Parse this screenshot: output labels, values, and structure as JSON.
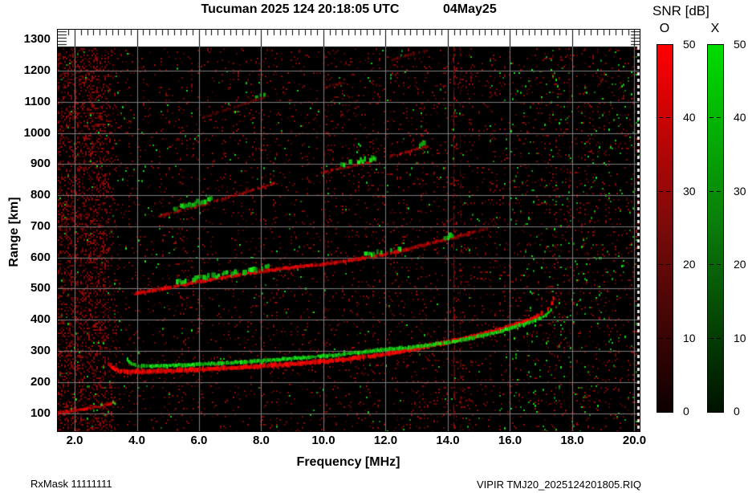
{
  "header": {
    "title": "Tucuman 2025 124 20:18:05 UTC",
    "date": "04May25"
  },
  "axes": {
    "x_label": "Frequency [MHz]",
    "y_label": "Range [km]",
    "x_ticks": [
      "2.0",
      "4.0",
      "6.0",
      "8.0",
      "10.0",
      "12.0",
      "14.0",
      "16.0",
      "18.0",
      "20.0"
    ],
    "y_ticks": [
      "100",
      "200",
      "300",
      "400",
      "500",
      "600",
      "700",
      "800",
      "900",
      "1000",
      "1100",
      "1200",
      "1300"
    ]
  },
  "colorbar_panel": {
    "title": "SNR [dB]",
    "scale_db": [
      0,
      50
    ],
    "bars": [
      {
        "label": "O",
        "top_color": "#ff0000",
        "mid_color": "#7a0a0a",
        "bottom_color": "#0d0000",
        "ticks": [
          "50",
          "40",
          "30",
          "20",
          "10",
          "0"
        ]
      },
      {
        "label": "X",
        "top_color": "#00dd00",
        "mid_color": "#0a7a0a",
        "bottom_color": "#001200",
        "ticks": [
          "50",
          "40",
          "30",
          "20",
          "10",
          "0"
        ]
      }
    ]
  },
  "footer": {
    "left": "RxMask 11111111",
    "right": "VIPIR  TMJ20_2025124201805.RIQ"
  },
  "chart_data": {
    "type": "heatmap",
    "title": "Tucuman 2025 124 20:18:05 UTC",
    "date": "04May25",
    "xlabel": "Frequency [MHz]",
    "ylabel": "Range [km]",
    "snr_scale_db": [
      0,
      50
    ],
    "o_mode_color": "#e60000",
    "x_mode_color": "#12c012",
    "grid": true,
    "grid_color": "#7d7d7d",
    "xlim_mhz": [
      1.458,
      20.168
    ],
    "ylim_km": [
      42,
      1332
    ],
    "data_top_km": 1277,
    "x_major_ticks_mhz": [
      2,
      4,
      6,
      8,
      10,
      12,
      14,
      16,
      18,
      20
    ],
    "x_minor_step_mhz": 0.2,
    "y_major_ticks_km": [
      100,
      200,
      300,
      400,
      500,
      600,
      700,
      800,
      900,
      1000,
      1100,
      1200,
      1300
    ],
    "series": [
      {
        "name": "E-layer O-trace",
        "mode": "O",
        "color": "#dd0404",
        "width": 3,
        "alpha": 0.85,
        "segments": [
          [
            [
              1.46,
              101
            ],
            [
              1.9,
              106
            ],
            [
              2.3,
              112
            ],
            [
              2.7,
              120
            ],
            [
              3.0,
              127
            ],
            [
              3.3,
              134
            ]
          ]
        ]
      },
      {
        "name": "E-layer X-patches",
        "mode": "X",
        "color": "#16c316",
        "width": 3,
        "alpha": 0.9,
        "blobby": true,
        "segments": [
          [
            [
              2.8,
              122
            ],
            [
              3.05,
              128
            ],
            [
              3.3,
              135
            ],
            [
              3.5,
              141
            ]
          ]
        ]
      },
      {
        "name": "1F O-trace",
        "mode": "O",
        "color": "#ee0800",
        "width": 5,
        "alpha": 1.0,
        "broken_from": 17.0,
        "segments": [
          [
            [
              3.14,
              254
            ],
            [
              3.25,
              243
            ],
            [
              3.45,
              236
            ],
            [
              3.8,
              233
            ],
            [
              4.3,
              233
            ],
            [
              5.0,
              236
            ],
            [
              6.0,
              240
            ],
            [
              7.0,
              245
            ],
            [
              8.0,
              251
            ],
            [
              9.0,
              258
            ],
            [
              10.0,
              266
            ],
            [
              10.8,
              274
            ],
            [
              11.6,
              284
            ],
            [
              12.4,
              296
            ],
            [
              13.1,
              310
            ],
            [
              13.8,
              324
            ],
            [
              14.5,
              339
            ],
            [
              15.1,
              353
            ],
            [
              15.7,
              369
            ],
            [
              16.2,
              385
            ],
            [
              16.6,
              399
            ],
            [
              16.9,
              412
            ],
            [
              17.1,
              425
            ],
            [
              17.25,
              440
            ],
            [
              17.37,
              456
            ],
            [
              17.45,
              472
            ],
            [
              17.5,
              486
            ]
          ]
        ]
      },
      {
        "name": "1F X-trace",
        "mode": "X",
        "color": "#14c414",
        "width": 4,
        "alpha": 0.95,
        "segments": [
          [
            [
              3.7,
              272
            ],
            [
              3.85,
              257
            ],
            [
              4.1,
              251
            ],
            [
              4.6,
              251
            ],
            [
              5.2,
              253
            ],
            [
              6.0,
              257
            ],
            [
              7.0,
              262
            ],
            [
              8.0,
              268
            ],
            [
              9.0,
              275
            ],
            [
              10.0,
              283
            ],
            [
              10.8,
              291
            ],
            [
              11.5,
              299
            ],
            [
              12.2,
              306
            ],
            [
              12.8,
              311
            ],
            [
              13.4,
              318
            ],
            [
              14.0,
              327
            ],
            [
              14.6,
              338
            ],
            [
              15.2,
              351
            ],
            [
              15.8,
              366
            ],
            [
              16.3,
              381
            ],
            [
              16.7,
              394
            ],
            [
              17.0,
              407
            ],
            [
              17.2,
              419
            ],
            [
              17.35,
              431
            ]
          ]
        ]
      },
      {
        "name": "2F O-trace",
        "mode": "O",
        "color": "#d40606",
        "width": 4,
        "alpha": 0.9,
        "fade": [
          11.5,
          0.35
        ],
        "segments": [
          [
            [
              3.95,
              484
            ],
            [
              4.5,
              494
            ],
            [
              5.1,
              505
            ],
            [
              5.7,
              517
            ],
            [
              6.3,
              528
            ],
            [
              6.9,
              538
            ],
            [
              7.5,
              548
            ],
            [
              8.1,
              557
            ],
            [
              8.8,
              566
            ],
            [
              9.5,
              574
            ],
            [
              10.2,
              581
            ],
            [
              10.8,
              590
            ],
            [
              11.4,
              600
            ],
            [
              12.0,
              610
            ],
            [
              12.6,
              624
            ],
            [
              13.2,
              639
            ],
            [
              13.7,
              653
            ],
            [
              14.2,
              664
            ],
            [
              14.7,
              677
            ],
            [
              15.0,
              686
            ],
            [
              15.3,
              694
            ]
          ]
        ]
      },
      {
        "name": "2F X-patches",
        "mode": "X",
        "color": "#14c414",
        "width": 4,
        "alpha": 0.9,
        "blobby": true,
        "segments": [
          [
            [
              5.3,
              520
            ],
            [
              5.9,
              531
            ],
            [
              6.5,
              541
            ],
            [
              7.1,
              551
            ],
            [
              7.7,
              560
            ],
            [
              8.3,
              569
            ]
          ],
          [
            [
              11.3,
              609
            ],
            [
              11.8,
              617
            ],
            [
              12.3,
              626
            ],
            [
              12.6,
              633
            ]
          ],
          [
            [
              13.9,
              664
            ],
            [
              14.2,
              670
            ]
          ]
        ]
      },
      {
        "name": "3F O-trace",
        "mode": "O",
        "color": "#c00808",
        "width": 3,
        "alpha": 0.65,
        "broken": true,
        "segments": [
          [
            [
              4.72,
              733
            ],
            [
              5.2,
              745
            ],
            [
              5.7,
              758
            ],
            [
              6.2,
              772
            ],
            [
              6.7,
              786
            ],
            [
              7.2,
              801
            ],
            [
              7.7,
              816
            ],
            [
              8.2,
              831
            ],
            [
              8.45,
              839
            ]
          ],
          [
            [
              9.9,
              872
            ],
            [
              10.4,
              882
            ],
            [
              10.9,
              893
            ],
            [
              11.4,
              905
            ],
            [
              11.75,
              914
            ]
          ],
          [
            [
              12.15,
              926
            ],
            [
              12.6,
              937
            ],
            [
              13.05,
              949
            ],
            [
              13.4,
              959
            ]
          ]
        ]
      },
      {
        "name": "3F X-patches",
        "mode": "X",
        "color": "#14c414",
        "width": 4,
        "alpha": 0.85,
        "blobby": true,
        "segments": [
          [
            [
              5.2,
              757
            ],
            [
              5.7,
              770
            ],
            [
              6.2,
              783
            ],
            [
              6.5,
              791
            ]
          ],
          [
            [
              10.6,
              898
            ],
            [
              11.0,
              906
            ],
            [
              11.4,
              915
            ],
            [
              11.7,
              922
            ]
          ],
          [
            [
              13.1,
              962
            ],
            [
              13.3,
              966
            ]
          ]
        ]
      },
      {
        "name": "4F O-trace",
        "mode": "O",
        "color": "#a80a0a",
        "width": 3,
        "alpha": 0.42,
        "broken": true,
        "segments": [
          [
            [
              6.15,
              1050
            ],
            [
              6.6,
              1065
            ],
            [
              7.1,
              1082
            ],
            [
              7.6,
              1098
            ],
            [
              8.25,
              1120
            ]
          ],
          [
            [
              10.05,
              1148
            ],
            [
              10.45,
              1157
            ],
            [
              10.75,
              1164
            ]
          ],
          [
            [
              12.2,
              1236
            ],
            [
              12.65,
              1248
            ],
            [
              13.1,
              1259
            ],
            [
              13.4,
              1266
            ]
          ]
        ]
      },
      {
        "name": "4F X-patches",
        "mode": "X",
        "color": "#14c414",
        "width": 3,
        "alpha": 0.8,
        "blobby": true,
        "segments": [
          [
            [
              7.85,
              1115
            ],
            [
              8.1,
              1122
            ],
            [
              8.3,
              1128
            ]
          ],
          [
            [
              12.5,
              1252
            ],
            [
              12.65,
              1256
            ]
          ]
        ]
      }
    ],
    "rfi_lines": [
      {
        "mhz": 14.18,
        "strength": 0.85
      },
      {
        "mhz": 14.38,
        "strength": 0.45
      },
      {
        "mhz": 10.02,
        "strength": 0.3
      },
      {
        "mhz": 12.12,
        "strength": 0.18
      },
      {
        "mhz": 15.35,
        "strength": 0.15
      },
      {
        "mhz": 17.9,
        "strength": 0.25
      }
    ],
    "noise": {
      "red_base": 0.05,
      "left_band_mhz": 3.6,
      "left_band_density": 0.34,
      "green_base": 0.0045,
      "green_right_mhz": 16.0,
      "green_right_density": 0.013,
      "patches": [
        {
          "f": [
            3.3,
            6.5
          ],
          "km": [
            195,
            231
          ],
          "d": 0.07
        },
        {
          "f": [
            3.5,
            5.2
          ],
          "km": [
            242,
            260
          ],
          "d": 0.05
        },
        {
          "f": [
            4.0,
            6.2
          ],
          "km": [
            468,
            486
          ],
          "d": 0.05
        }
      ]
    }
  }
}
